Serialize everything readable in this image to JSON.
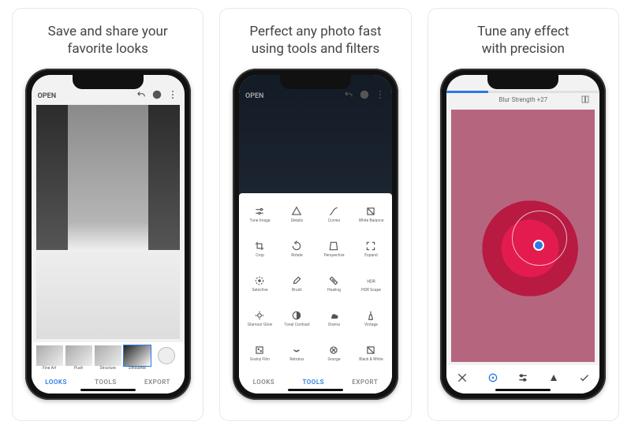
{
  "captions": {
    "panel1_l1": "Save and share your",
    "panel1_l2": "favorite looks",
    "panel2_l1": "Perfect any photo fast",
    "panel2_l2": "using tools and filters",
    "panel3_l1": "Tune any effect",
    "panel3_l2": "with precision"
  },
  "screen1": {
    "open": "OPEN",
    "looks": [
      "Fine Art",
      "Push",
      "Structure",
      "Silhouette"
    ],
    "tabs": {
      "looks": "LOOKS",
      "tools": "TOOLS",
      "export": "EXPORT"
    }
  },
  "screen2": {
    "open": "OPEN",
    "tools": [
      "Tune Image",
      "Details",
      "Curves",
      "White Balance",
      "Crop",
      "Rotate",
      "Perspective",
      "Expand",
      "Selective",
      "Brush",
      "Healing",
      "HDR Scape",
      "Glamour Glow",
      "Tonal Contrast",
      "Drama",
      "Vintage",
      "Grainy Film",
      "Retrolux",
      "Grunge",
      "Black & White"
    ],
    "tabs": {
      "looks": "LOOKS",
      "tools": "TOOLS",
      "export": "EXPORT"
    }
  },
  "screen3": {
    "effect_label": "Blur Strength +27",
    "progress_pct": 27
  }
}
